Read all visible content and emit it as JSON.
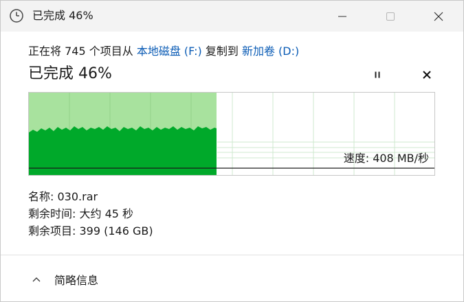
{
  "window": {
    "title": "已完成 46%",
    "icon": "clock-icon",
    "controls": [
      "minimize-icon",
      "maximize-icon",
      "close-icon"
    ]
  },
  "summary": {
    "prefix": "正在将 745 个项目从",
    "source": "本地磁盘 (F:)",
    "middle": "复制到",
    "destination": "新加卷 (D:)"
  },
  "status": {
    "text": "已完成 46%",
    "progress_percent": 46,
    "pause_icon": "pause-icon",
    "cancel_icon": "cancel-x-icon"
  },
  "graph": {
    "speed_label": "速度: 408 MB/秒",
    "fill_color": "#00a92a",
    "progress_color": "#a8e29e"
  },
  "details": {
    "name_label": "名称:",
    "name_value": "030.rar",
    "time_label": "剩余时间:",
    "time_value": "大约 45 秒",
    "items_label": "剩余项目:",
    "items_value": "399 (146 GB)"
  },
  "footer": {
    "toggle_label": "简略信息",
    "toggle_icon": "chevron-up-icon"
  }
}
